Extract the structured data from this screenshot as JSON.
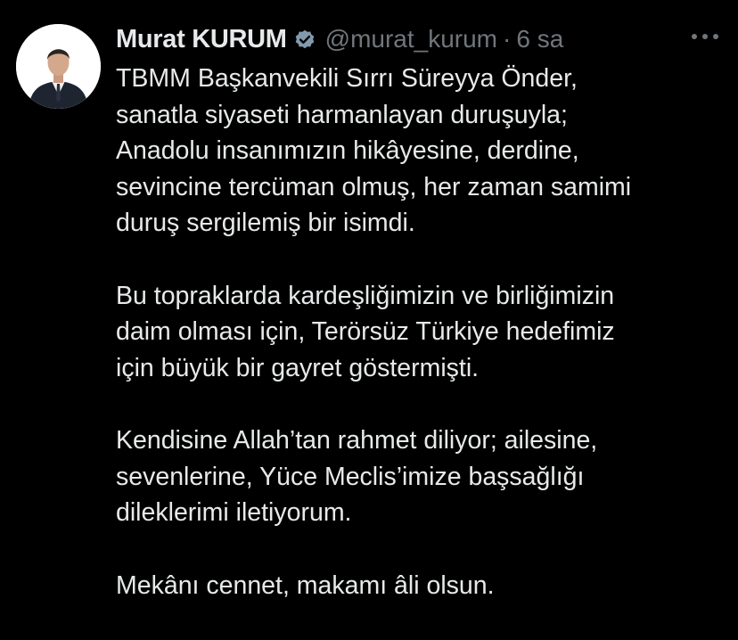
{
  "tweet": {
    "display_name": "Murat KURUM",
    "handle": "@murat_kurum",
    "separator": "·",
    "time": "6 sa",
    "icons": {
      "avatar": "profile-photo",
      "verified": "verified-badge-icon",
      "more": "more-options-icon"
    },
    "colors": {
      "background": "#000000",
      "text": "#e7e9ea",
      "secondary": "#71767b",
      "verified_badge": "#829aab"
    },
    "paragraphs": [
      {
        "lines": [
          "TBMM Başkanvekili Sırrı Süreyya Önder,",
          "sanatla siyaseti harmanlayan duruşuyla;",
          "Anadolu insanımızın hikâyesine, derdine,",
          "sevincine tercüman olmuş, her zaman samimi",
          "duruş sergilemiş bir isimdi."
        ]
      },
      {
        "lines": [
          "Bu topraklarda kardeşliğimizin ve birliğimizin",
          "daim olması için, Terörsüz Türkiye hedefimiz",
          "için büyük bir gayret göstermişti."
        ]
      },
      {
        "lines": [
          "Kendisine Allah’tan rahmet diliyor; ailesine,",
          "sevenlerine, Yüce Meclis’imize başsağlığı",
          "dileklerimi iletiyorum."
        ]
      },
      {
        "lines": [
          "Mekânı cennet, makamı âli olsun."
        ]
      }
    ]
  }
}
